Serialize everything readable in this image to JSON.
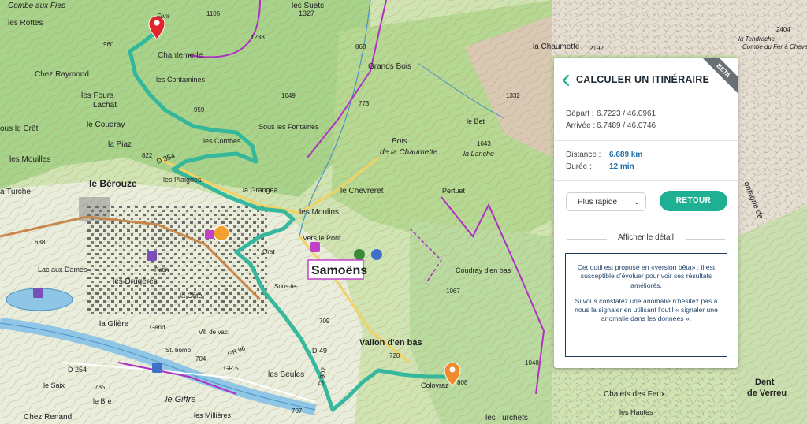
{
  "map": {
    "labels": {
      "combe_aux_fies": "Combe aux Fies",
      "les_rottes": "les Rottes",
      "chez_raymond": "Chez Raymond",
      "les_fours": "les Fours",
      "lachat": "Lachat",
      "le_cret": "ous le Crêt",
      "coudray": "le Coudray",
      "la_piaz": "la Piaz",
      "les_mouilles": "les Mouilles",
      "la_turche": "a Turche",
      "le_berouze": "le Bérouze",
      "plaignes": "les Plaignes",
      "la_grangea": "la Grangea",
      "les_moulins": "les Moulins",
      "le_chevreret": "le Chevreret",
      "vers_le_pont": "Vers le Pont",
      "samoens": "Samoëns",
      "sous_le_bourg": "Sous-le-...",
      "lac_aux_dames": "Lac aux Dames",
      "drugeres": "les Drugères",
      "la_gliere": "la Glière",
      "la_cote": "la Côte",
      "vallon_en_bas": "Vallon d'en bas",
      "les_beules": "les Beules",
      "le_giffre": "le Giffre",
      "chez_renand": "Chez Renand",
      "le_saix": "le Saix",
      "le_bre": "le Bré",
      "les_millieres": "les Millières",
      "colovraz": "Colovraz",
      "les_turchets": "les Turchets",
      "chalets_des_feux": "Chalets des Feux",
      "les_hautes": "les Hautes",
      "dent_de_verreu_1": "Dent",
      "dent_de_verreu_2": "de Verreu",
      "la_chaumette": "la Chaumette",
      "bois_de_la_chaumette_1": "Bois",
      "bois_de_la_chaumette_2": "de la Chaumette",
      "la_lanche": "la Lanche",
      "le_bet": "le Bet",
      "grands_bois": "Grands Bois",
      "les_suets": "les Suets",
      "chantemerle": "Chantemerle",
      "les_contamines": "les Contamines",
      "les_combes": "les Combes",
      "sous_fontaines": "Sous les Fontaines",
      "pertuet": "Pertuet",
      "coudray_en_bas": "Coudray d'en bas",
      "la_tendrache": "la Tendrache",
      "combe_du_fer": "Combe du Fer à Cheval",
      "montagne_de": "ontagne de",
      "d354": "D 354",
      "d49": "D 49",
      "d907": "D 907",
      "d254": "D 254",
      "font": "Font",
      "alt_1327": "1327",
      "alt_1238": "1238",
      "alt_1105": "1105",
      "alt_960": "960",
      "alt_1049": "1049",
      "alt_773": "773",
      "alt_1643": "1643",
      "alt_1332": "1332",
      "alt_2192": "2192",
      "alt_2404": "2404",
      "alt_1067": "1067",
      "alt_1048": "1048",
      "alt_704": "704",
      "alt_709": "709",
      "alt_688": "688",
      "alt_785": "785",
      "alt_720": "720",
      "alt_808": "808",
      "alt_707": "707",
      "alt_863": "863",
      "alt_822": "822",
      "alt_959": "959",
      "orat": "Orat",
      "ville_de_vac": "Vil. de vac.",
      "st_bomp": "St. bomp",
      "gend": "Gend.",
      "patin": "Patin",
      "gr96": "GR 96",
      "gr5": "GR 5"
    },
    "route_color": "#2db59b",
    "start_marker_color": "#e0262b",
    "end_marker_color": "#f08a2a"
  },
  "panel": {
    "title": "CALCULER UN ITINÉRAIRE",
    "beta": "BETA",
    "depart_label": "Départ :",
    "depart_value": "6.7223 / 46.0961",
    "arrivee_label": "Arrivée :",
    "arrivee_value": "6.7489 / 46.0746",
    "distance_label": "Distance :",
    "distance_value": "6.689 km",
    "duree_label": "Durée :",
    "duree_value": "12 min",
    "mode_selected": "Plus rapide",
    "retour_label": "RETOUR",
    "detail_label": "Afficher le détail",
    "notice_p1": "Cet outil est proposé en «version bêta» : il est susceptible d'évoluer pour voir ses résultats améliorés.",
    "notice_p2": "Si vous constatez une anomalie n'hésitez pas à nous la signaler en utilisant l'outil « signaler une anomalie dans les données ».",
    "accent_color": "#1faf93"
  }
}
